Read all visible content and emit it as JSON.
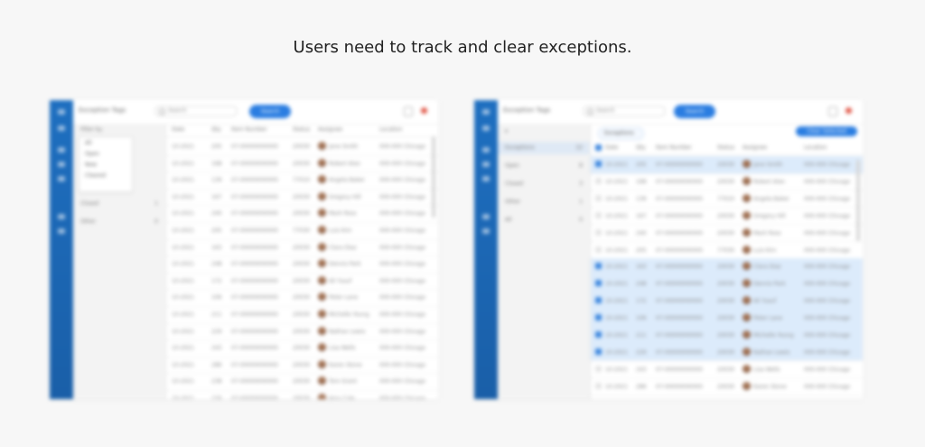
{
  "headline": "Users need to track and clear exceptions.",
  "colors": {
    "accent": "#2a7de1",
    "rail": "#1e6fc0",
    "selected_row": "#dcebfb",
    "close": "#e05545"
  },
  "icons": [
    "search-icon",
    "filter-icon",
    "print-icon",
    "close-icon"
  ],
  "left": {
    "app_title": "Exception Tags",
    "search_value": "Search",
    "primary_button": "Search",
    "filter_label": "Filter by",
    "dropdown_options": [
      "All",
      "Open",
      "New",
      "Cleared"
    ],
    "panel_items": [
      {
        "label": "All",
        "count": "12"
      },
      {
        "label": "Open",
        "count": "8"
      },
      {
        "label": "New",
        "count": "3"
      },
      {
        "label": "Closed",
        "count": "1"
      },
      {
        "label": "Other",
        "count": "0"
      }
    ],
    "headers": [
      "Date",
      "Qty",
      "Item Number",
      "Status",
      "Assignee",
      "Location"
    ],
    "rows": [
      [
        "10-2021",
        "205",
        "07-00000000000",
        "20030",
        "Jane Smith",
        "000-000 Chicago"
      ],
      [
        "10-2021",
        "168",
        "07-00000000000",
        "20030",
        "Robert Alan",
        "000-000 Chicago"
      ],
      [
        "10-2021",
        "139",
        "07-00000000000",
        "77010",
        "Angela Baker",
        "000-000 Chicago"
      ],
      [
        "10-2021",
        "167",
        "07-00000000000",
        "20030",
        "Gregory Hill",
        "000-000 Chicago"
      ],
      [
        "10-2021",
        "240",
        "07-00000000000",
        "20030",
        "Mark Ross",
        "000-000 Chicago"
      ],
      [
        "10-2021",
        "205",
        "07-00000000000",
        "77030",
        "Luis Kim",
        "000-000 Chicago"
      ],
      [
        "10-2021",
        "163",
        "07-00000000000",
        "20030",
        "Clara Diaz",
        "000-000 Chicago"
      ],
      [
        "10-2021",
        "248",
        "07-00000000000",
        "20030",
        "Dennis Park",
        "000-000 Chicago"
      ],
      [
        "10-2021",
        "172",
        "07-00000000000",
        "20030",
        "Ali Yusuf",
        "000-000 Chicago"
      ],
      [
        "10-2021",
        "106",
        "07-00000000000",
        "20030",
        "Peter Lane",
        "000-000 Chicago"
      ],
      [
        "10-2021",
        "211",
        "07-00000000000",
        "20030",
        "Michelle Young",
        "000-000 Chicago"
      ],
      [
        "10-2021",
        "229",
        "07-00000000000",
        "20030",
        "Nathan Lewis",
        "000-000 Chicago"
      ],
      [
        "10-2021",
        "243",
        "07-00000000000",
        "20030",
        "Lisa Wells",
        "000-000 Chicago"
      ],
      [
        "10-2021",
        "286",
        "07-00000000000",
        "20030",
        "Karen Stone",
        "000-000 Chicago"
      ],
      [
        "10-2021",
        "238",
        "07-00000000000",
        "20030",
        "Tom Grant",
        "000-000 Chicago"
      ],
      [
        "10-2021",
        "226",
        "07-00000000000",
        "20030",
        "Amy Cole",
        "000-000 Chicago"
      ]
    ]
  },
  "right": {
    "app_title": "Exception Tags",
    "search_value": "Search",
    "primary_button": "Search",
    "filter_chip": "Exceptions",
    "action_button": "Clear Selected",
    "panel_items": [
      {
        "label": "Exceptions",
        "count": "12"
      },
      {
        "label": "Open",
        "count": "8"
      },
      {
        "label": "Closed",
        "count": "3"
      },
      {
        "label": "Other",
        "count": "1"
      },
      {
        "label": "All",
        "count": "0"
      }
    ],
    "headers": [
      "Date",
      "Qty",
      "Item Number",
      "Status",
      "Assignee",
      "Location"
    ],
    "rows": [
      {
        "sel": true,
        "cells": [
          "10-2021",
          "205",
          "07-00000000000",
          "20030",
          "Jane Smith",
          "000-000 Chicago"
        ]
      },
      {
        "sel": false,
        "cells": [
          "10-2021",
          "168",
          "07-00000000000",
          "20030",
          "Robert Alan",
          "000-000 Chicago"
        ]
      },
      {
        "sel": false,
        "cells": [
          "10-2021",
          "139",
          "07-00000000000",
          "77010",
          "Angela Baker",
          "000-000 Chicago"
        ]
      },
      {
        "sel": false,
        "cells": [
          "10-2021",
          "167",
          "07-00000000000",
          "20030",
          "Gregory Hill",
          "000-000 Chicago"
        ]
      },
      {
        "sel": false,
        "cells": [
          "10-2021",
          "240",
          "07-00000000000",
          "20030",
          "Mark Ross",
          "000-000 Chicago"
        ]
      },
      {
        "sel": false,
        "cells": [
          "10-2021",
          "205",
          "07-00000000000",
          "77030",
          "Luis Kim",
          "000-000 Chicago"
        ]
      },
      {
        "sel": true,
        "cells": [
          "10-2021",
          "163",
          "07-00000000000",
          "20030",
          "Clara Diaz",
          "000-000 Chicago"
        ]
      },
      {
        "sel": true,
        "cells": [
          "10-2021",
          "248",
          "07-00000000000",
          "20030",
          "Dennis Park",
          "000-000 Chicago"
        ]
      },
      {
        "sel": true,
        "cells": [
          "10-2021",
          "172",
          "07-00000000000",
          "20030",
          "Ali Yusuf",
          "000-000 Chicago"
        ]
      },
      {
        "sel": true,
        "cells": [
          "10-2021",
          "106",
          "07-00000000000",
          "20030",
          "Peter Lane",
          "000-000 Chicago"
        ]
      },
      {
        "sel": true,
        "cells": [
          "10-2021",
          "211",
          "07-00000000000",
          "20030",
          "Michelle Young",
          "000-000 Chicago"
        ]
      },
      {
        "sel": true,
        "cells": [
          "10-2021",
          "229",
          "07-00000000000",
          "20030",
          "Nathan Lewis",
          "000-000 Chicago"
        ]
      },
      {
        "sel": false,
        "cells": [
          "10-2021",
          "243",
          "07-00000000000",
          "20030",
          "Lisa Wells",
          "000-000 Chicago"
        ]
      },
      {
        "sel": false,
        "cells": [
          "10-2021",
          "286",
          "07-00000000000",
          "20030",
          "Karen Stone",
          "000-000 Chicago"
        ]
      }
    ]
  }
}
